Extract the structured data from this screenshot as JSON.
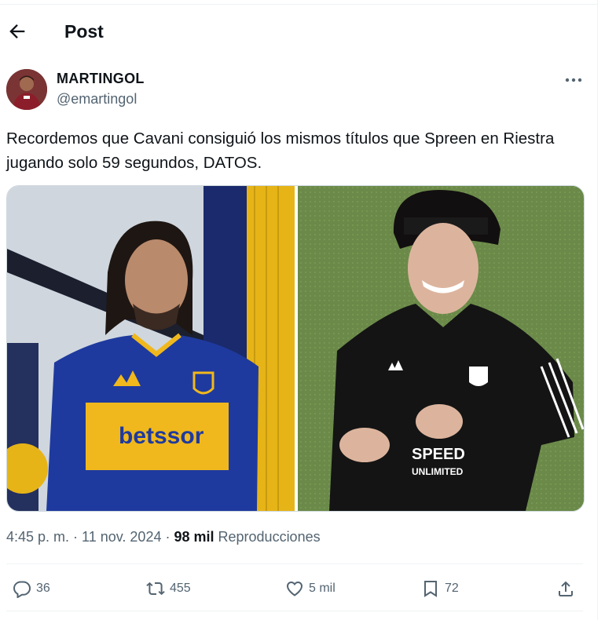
{
  "header": {
    "title": "Post"
  },
  "author": {
    "name": "MARTINGOL",
    "handle": "@emartingol"
  },
  "post": {
    "text": "Recordemos que Cavani consiguió los mismos títulos que Spreen en Riestra jugando solo 59 segundos, DATOS."
  },
  "media": {
    "left_jersey_text": "betssor",
    "right_jersey_text_1": "SPEED",
    "right_jersey_text_2": "UNLIMITED"
  },
  "meta": {
    "time": "4:45 p. m.",
    "date": "11 nov. 2024",
    "views": "98 mil",
    "views_label": "Reproducciones"
  },
  "actions": {
    "replies": "36",
    "reposts": "455",
    "likes": "5 mil",
    "bookmarks": "72"
  },
  "colors": {
    "text": "#0f1419",
    "muted": "#536471",
    "border": "#eff3f4"
  },
  "icons": [
    "back-arrow-icon",
    "more-icon",
    "reply-icon",
    "repost-icon",
    "like-icon",
    "bookmark-icon",
    "share-icon"
  ]
}
